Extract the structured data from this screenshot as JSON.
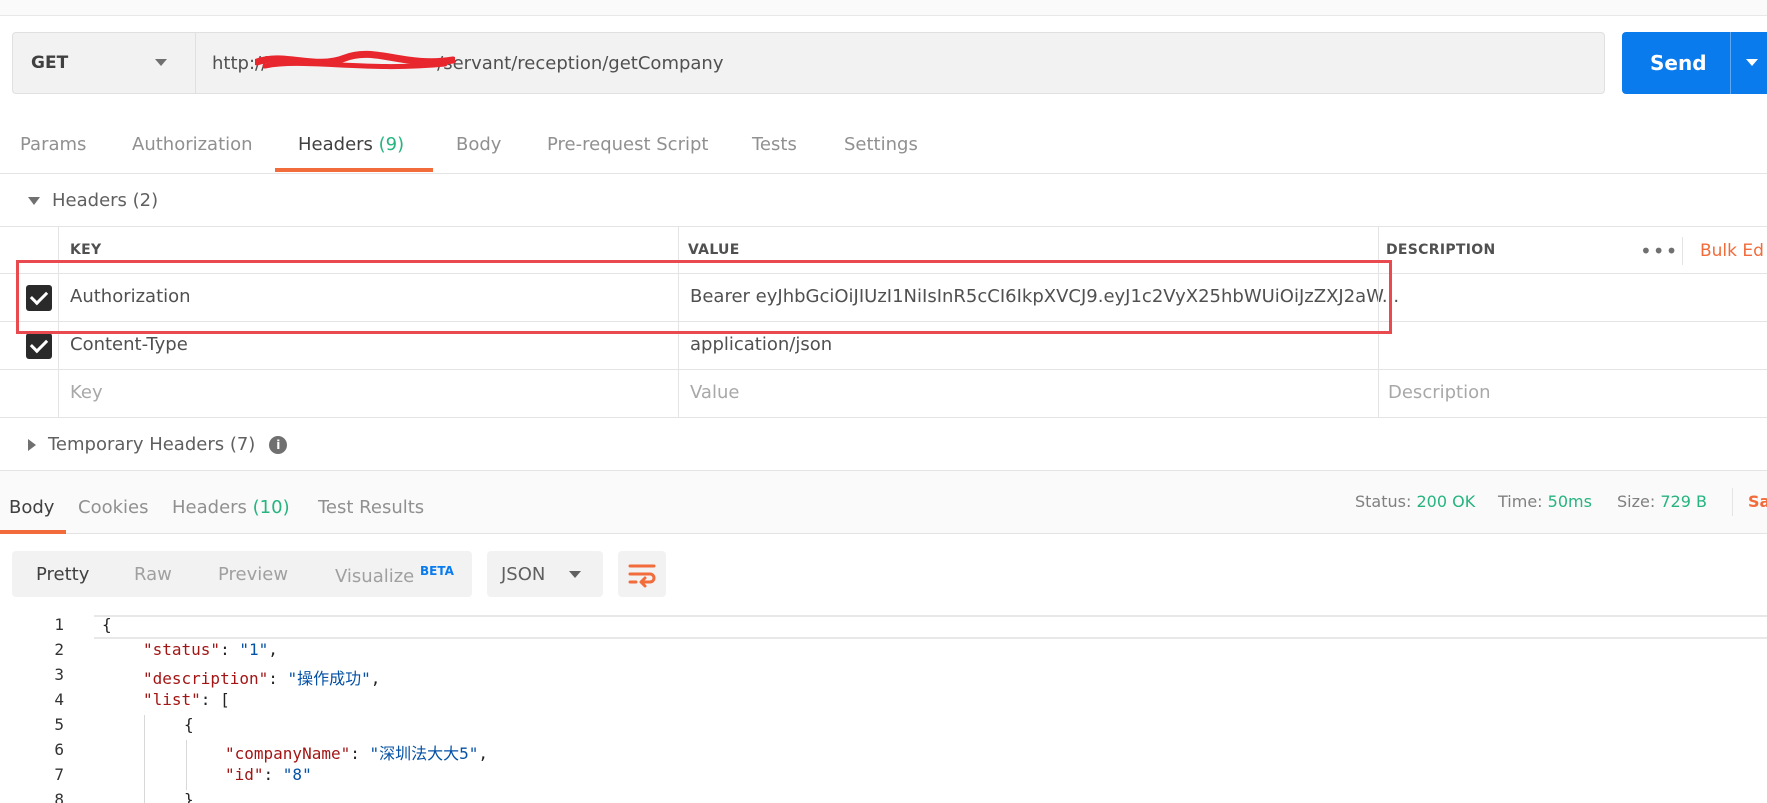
{
  "request": {
    "method": "GET",
    "url_visible_prefix": "http://",
    "url_visible_suffix": "/servant/reception/getCompany",
    "send_label": "Send"
  },
  "request_tabs": [
    {
      "label": "Params"
    },
    {
      "label": "Authorization"
    },
    {
      "label": "Headers",
      "count": "(9)"
    },
    {
      "label": "Body"
    },
    {
      "label": "Pre-request Script"
    },
    {
      "label": "Tests"
    },
    {
      "label": "Settings"
    }
  ],
  "headers_section": {
    "title": "Headers (2)",
    "columns": {
      "key": "KEY",
      "value": "VALUE",
      "description": "DESCRIPTION"
    },
    "bulk_edit": "Bulk Ed",
    "rows": [
      {
        "key": "Authorization",
        "value": "Bearer eyJhbGciOiJIUzI1NiIsInR5cCI6IkpXVCJ9.eyJ1c2VyX25hbWUiOiJzZXJ2aW...",
        "checked": true
      },
      {
        "key": "Content-Type",
        "value": "application/json",
        "checked": true
      }
    ],
    "placeholder": {
      "key": "Key",
      "value": "Value",
      "description": "Description"
    }
  },
  "temporary_headers": "Temporary Headers (7)",
  "response_tabs": [
    {
      "label": "Body"
    },
    {
      "label": "Cookies"
    },
    {
      "label": "Headers",
      "count": "(10)"
    },
    {
      "label": "Test Results"
    }
  ],
  "status": {
    "status_label": "Status:",
    "status_value": "200 OK",
    "time_label": "Time:",
    "time_value": "50ms",
    "size_label": "Size:",
    "size_value": "729 B",
    "save_label": "Sa"
  },
  "view_modes": [
    "Pretty",
    "Raw",
    "Preview",
    "Visualize"
  ],
  "beta_label": "BETA",
  "format": "JSON",
  "code_lines": [
    {
      "n": "1",
      "text": "{"
    },
    {
      "n": "2",
      "key": "\"status\"",
      "val": "\"1\"",
      "tail": ","
    },
    {
      "n": "3",
      "key": "\"description\"",
      "val": "\"操作成功\"",
      "tail": ","
    },
    {
      "n": "4",
      "key": "\"list\"",
      "tail": ": ["
    },
    {
      "n": "5",
      "text": "{"
    },
    {
      "n": "6",
      "key": "\"companyName\"",
      "val": "\"深圳法大大5\"",
      "tail": ","
    },
    {
      "n": "7",
      "key": "\"id\"",
      "val": "\"8\""
    },
    {
      "n": "8",
      "text": "}"
    }
  ],
  "colors": {
    "accent": "#f26b3a",
    "send": "#097bed",
    "green": "#26b47f",
    "highlight": "#e84a4f"
  }
}
